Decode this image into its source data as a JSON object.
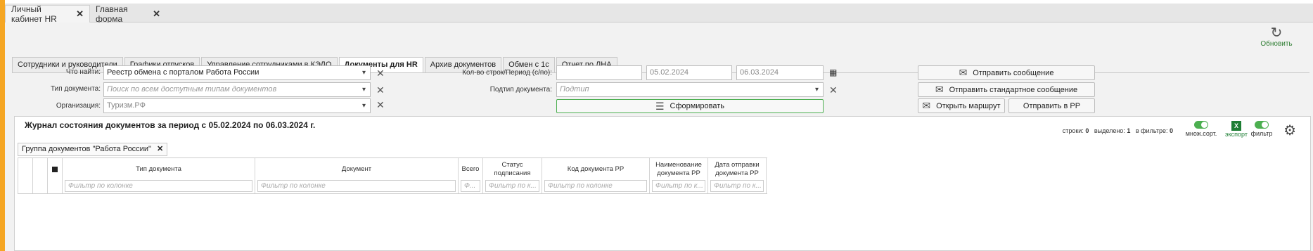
{
  "window_tabs": [
    {
      "label": "Личный кабинет HR",
      "active": true
    },
    {
      "label": "Главная форма",
      "active": false
    }
  ],
  "refresh_label": "Обновить",
  "section_tabs": [
    {
      "label": "Сотрудники и руководители"
    },
    {
      "label": "Графики отпусков"
    },
    {
      "label": "Управление сотрудниками в КЭДО"
    },
    {
      "label": "Документы для HR",
      "active": true
    },
    {
      "label": "Архив документов"
    },
    {
      "label": "Обмен с 1с"
    },
    {
      "label": "Отчет по ЛНА"
    }
  ],
  "filters": {
    "search_label": "Что найти:",
    "search_value": "Реестр обмена с порталом Работа России",
    "doc_type_label": "Тип документа:",
    "doc_type_placeholder": "Поиск по всем доступным типам документов",
    "org_label": "Организация:",
    "org_value": "Туризм.РФ",
    "rows_period_label": "Кол-во строк/Период (с/по):",
    "rows_value": "",
    "date_from": "05.02.2024",
    "date_to": "06.03.2024",
    "subtype_label": "Подтип документа:",
    "subtype_placeholder": "Подтип"
  },
  "actions": {
    "generate": "Сформировать",
    "send_message": "Отправить сообщение",
    "send_standard_message": "Отправить стандартное сообщение",
    "open_route": "Открыть маршрут",
    "send_to_rr": "Отправить в РР"
  },
  "journal": {
    "title": "Журнал состояния документов за период с 05.02.2024 по 06.03.2024 г.",
    "rows_label": "строки:",
    "rows_count": "0",
    "selected_label": "выделено:",
    "selected_count": "1",
    "in_filter_label": "в фильтре:",
    "in_filter_count": "0",
    "multisort_label": "множ.сорт.",
    "export_label": "экспорт",
    "filter_label": "фильтр",
    "group_chip": "Группа документов \"Работа России\""
  },
  "columns": [
    {
      "header": "",
      "filter": ""
    },
    {
      "header": "",
      "filter": ""
    },
    {
      "header": "",
      "filter": ""
    },
    {
      "header": "Тип документа",
      "filter": "Фильтр по колонке"
    },
    {
      "header": "Документ",
      "filter": "Фильтр по колонке"
    },
    {
      "header": "Всего",
      "filter": "Ф..."
    },
    {
      "header": "Статус подписания",
      "filter": "Фильтр по к..."
    },
    {
      "header": "Код документа РР",
      "filter": "Фильтр по колонке"
    },
    {
      "header": "Наименование документа РР",
      "filter": "Фильтр по к..."
    },
    {
      "header": "Дата отправки документа РР",
      "filter": "Фильтр по к..."
    }
  ],
  "colors": {
    "accent": "#f5a623",
    "green": "#2e7d32",
    "excel": "#1e7e34"
  }
}
